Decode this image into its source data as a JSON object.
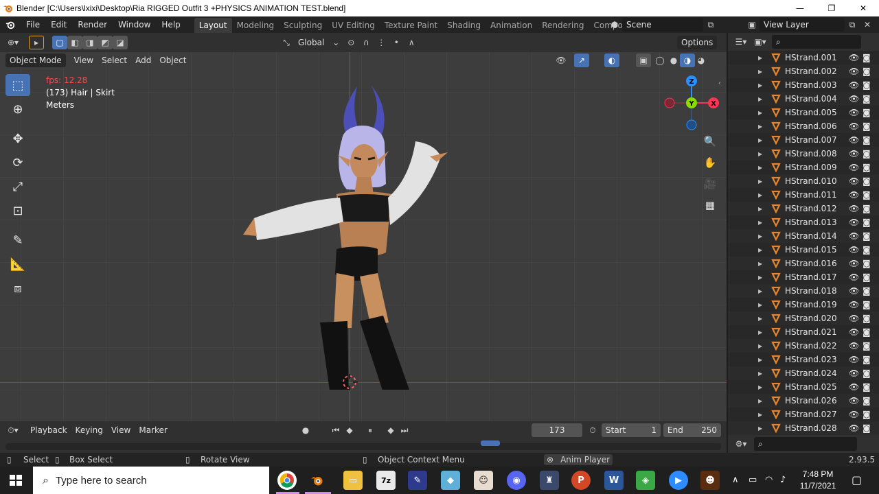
{
  "window": {
    "title": "Blender [C:\\Users\\lxixi\\Desktop\\Ria RIGGED Outfit 3 +PHYSICS ANIMATION TEST.blend]",
    "minimize": "—",
    "maximize": "❐",
    "close": "✕"
  },
  "menu": [
    "File",
    "Edit",
    "Render",
    "Window",
    "Help"
  ],
  "workspaces": [
    "Layout",
    "Modeling",
    "Sculpting",
    "UV Editing",
    "Texture Paint",
    "Shading",
    "Animation",
    "Rendering",
    "Compos"
  ],
  "scene": "Scene",
  "view_layer": "View Layer",
  "tool_header": {
    "transform_orientation": "Global",
    "options": "Options"
  },
  "view_header": {
    "mode": "Object Mode",
    "menus": [
      "View",
      "Select",
      "Add",
      "Object"
    ]
  },
  "viewport_overlay": {
    "fps": "fps: 12.28",
    "object_info": "(173) Hair | Skirt",
    "units": "Meters"
  },
  "gizmo": {
    "z": "Z",
    "y": "Y",
    "x": "X"
  },
  "outliner": {
    "items": [
      "HStrand.001",
      "HStrand.002",
      "HStrand.003",
      "HStrand.004",
      "HStrand.005",
      "HStrand.006",
      "HStrand.007",
      "HStrand.008",
      "HStrand.009",
      "HStrand.010",
      "HStrand.011",
      "HStrand.012",
      "HStrand.013",
      "HStrand.014",
      "HStrand.015",
      "HStrand.016",
      "HStrand.017",
      "HStrand.018",
      "HStrand.019",
      "HStrand.020",
      "HStrand.021",
      "HStrand.022",
      "HStrand.023",
      "HStrand.024",
      "HStrand.025",
      "HStrand.026",
      "HStrand.027",
      "HStrand.028"
    ]
  },
  "timeline": {
    "menus": [
      "Playback",
      "Keying",
      "View",
      "Marker"
    ],
    "current_frame": "173",
    "start_label": "Start",
    "start": "1",
    "end_label": "End",
    "end": "250"
  },
  "statusbar": {
    "select": "Select",
    "box_select": "Box Select",
    "rotate_view": "Rotate View",
    "context_menu": "Object Context Menu",
    "anim_player": "Anim Player",
    "version": "2.93.5"
  },
  "taskbar": {
    "search_placeholder": "Type here to search",
    "time": "7:48 PM",
    "date": "11/7/2021"
  },
  "colors": {
    "accent_blue": "#4772b3",
    "axis_x": "#ff3352",
    "axis_y": "#8bdc00",
    "axis_z": "#2890ff",
    "fps_red": "#ff4b4b"
  }
}
